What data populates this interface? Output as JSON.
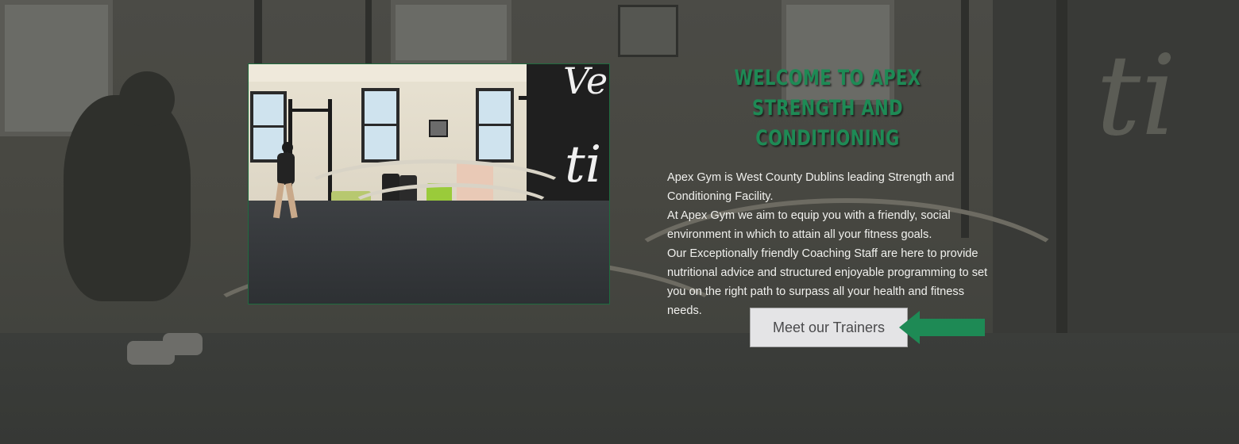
{
  "hero": {
    "title": "WELCOME TO APEX STRENGTH AND CONDITIONING",
    "paragraphs": [
      "Apex Gym is West County Dublins leading Strength and Conditioning Facility.",
      "At Apex Gym we aim to equip you with a friendly, social environment in which to attain all your fitness goals.",
      "Our Exceptionally friendly Coaching Staff are here to provide nutritional advice and structured enjoyable programming to set you on the right path to surpass all your health and fitness needs."
    ],
    "cta_label": "Meet our Trainers"
  },
  "colors": {
    "accent": "#1e8a55",
    "button_bg": "#e4e4e6",
    "overlay_bg": "#3a3b38"
  },
  "icons": {
    "cta_pointer": "arrow-left-icon"
  }
}
